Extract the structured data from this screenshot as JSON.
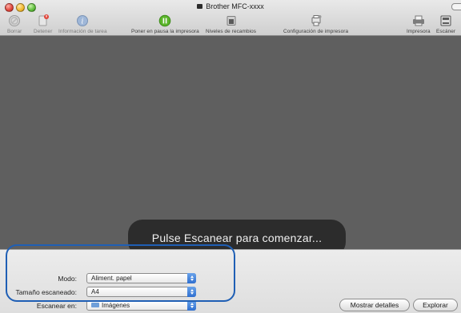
{
  "window": {
    "title": "Brother MFC-xxxx"
  },
  "toolbar": {
    "borrar": "Borrar",
    "detener": "Detener",
    "info": "Información de tarea",
    "pausa": "Poner en pausa la impresora",
    "niveles": "Niveles de recambios",
    "config": "Configuración de impresora",
    "impresora": "Impresora",
    "escaner": "Escáner"
  },
  "status": {
    "message": "Pulse Escanear para comenzar..."
  },
  "settings": {
    "modo_label": "Modo:",
    "modo_value": "Aliment. papel",
    "tamano_label": "Tamaño escaneado:",
    "tamano_value": "A4",
    "escanear_en_label": "Escanear en:",
    "escanear_en_value": "Imágenes"
  },
  "buttons": {
    "detalles": "Mostrar detalles",
    "explorar": "Explorar"
  },
  "colors": {
    "accent": "#2f6fd0",
    "highlight": "#1f5fb5",
    "pause": "#5bb52a",
    "content_bg": "#5f5f5f"
  }
}
